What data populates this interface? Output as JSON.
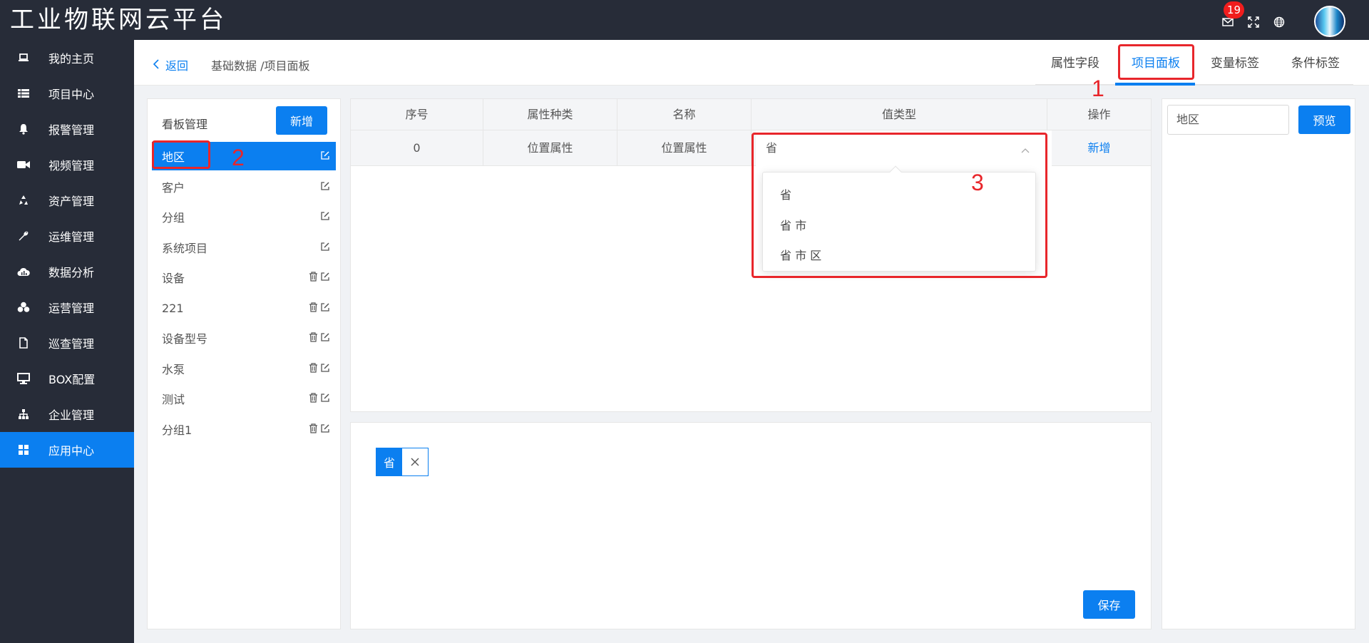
{
  "app": {
    "title": "工业物联网云平台",
    "notification_count": "19"
  },
  "sidebar": {
    "items": [
      {
        "label": "我的主页",
        "icon": "laptop-icon"
      },
      {
        "label": "项目中心",
        "icon": "list-icon"
      },
      {
        "label": "报警管理",
        "icon": "bell-icon"
      },
      {
        "label": "视频管理",
        "icon": "video-icon"
      },
      {
        "label": "资产管理",
        "icon": "recycle-icon"
      },
      {
        "label": "运维管理",
        "icon": "wrench-icon"
      },
      {
        "label": "数据分析",
        "icon": "cloud-chart-icon"
      },
      {
        "label": "运营管理",
        "icon": "cubes-icon"
      },
      {
        "label": "巡查管理",
        "icon": "file-icon"
      },
      {
        "label": "BOX配置",
        "icon": "monitor-icon"
      },
      {
        "label": "企业管理",
        "icon": "org-chart-icon"
      },
      {
        "label": "应用中心",
        "icon": "grid-icon",
        "active": true
      }
    ]
  },
  "header": {
    "back_label": "返回",
    "breadcrumb": "基础数据 /项目面板",
    "tabs": [
      {
        "label": "属性字段"
      },
      {
        "label": "项目面板",
        "active": true
      },
      {
        "label": "变量标签"
      },
      {
        "label": "条件标签"
      }
    ]
  },
  "board": {
    "title": "看板管理",
    "add_label": "新增",
    "items": [
      {
        "label": "地区",
        "active": true,
        "deletable": false
      },
      {
        "label": "客户",
        "deletable": false
      },
      {
        "label": "分组",
        "deletable": false
      },
      {
        "label": "系统项目",
        "deletable": false
      },
      {
        "label": "设备",
        "deletable": true
      },
      {
        "label": "221",
        "deletable": true
      },
      {
        "label": "设备型号",
        "deletable": true
      },
      {
        "label": "水泵",
        "deletable": true
      },
      {
        "label": "测试",
        "deletable": true
      },
      {
        "label": "分组1",
        "deletable": true
      }
    ]
  },
  "table": {
    "columns": [
      "序号",
      "属性种类",
      "名称",
      "值类型",
      "操作"
    ],
    "rows": [
      {
        "index": "0",
        "kind": "位置属性",
        "name": "位置属性",
        "value_type": "省",
        "action": "新增"
      }
    ]
  },
  "dropdown": {
    "options": [
      "省",
      "省 市",
      "省 市 区"
    ]
  },
  "tags": {
    "items": [
      {
        "label": "省"
      }
    ],
    "save_label": "保存"
  },
  "preview": {
    "input_value": "地区",
    "button_label": "预览"
  },
  "annotations": {
    "labels": [
      "1",
      "2",
      "3"
    ],
    "color": "#e8262b"
  },
  "colors": {
    "primary": "#0b7ff0",
    "sidebar_bg": "#272c38",
    "badge": "#f01d1d"
  }
}
